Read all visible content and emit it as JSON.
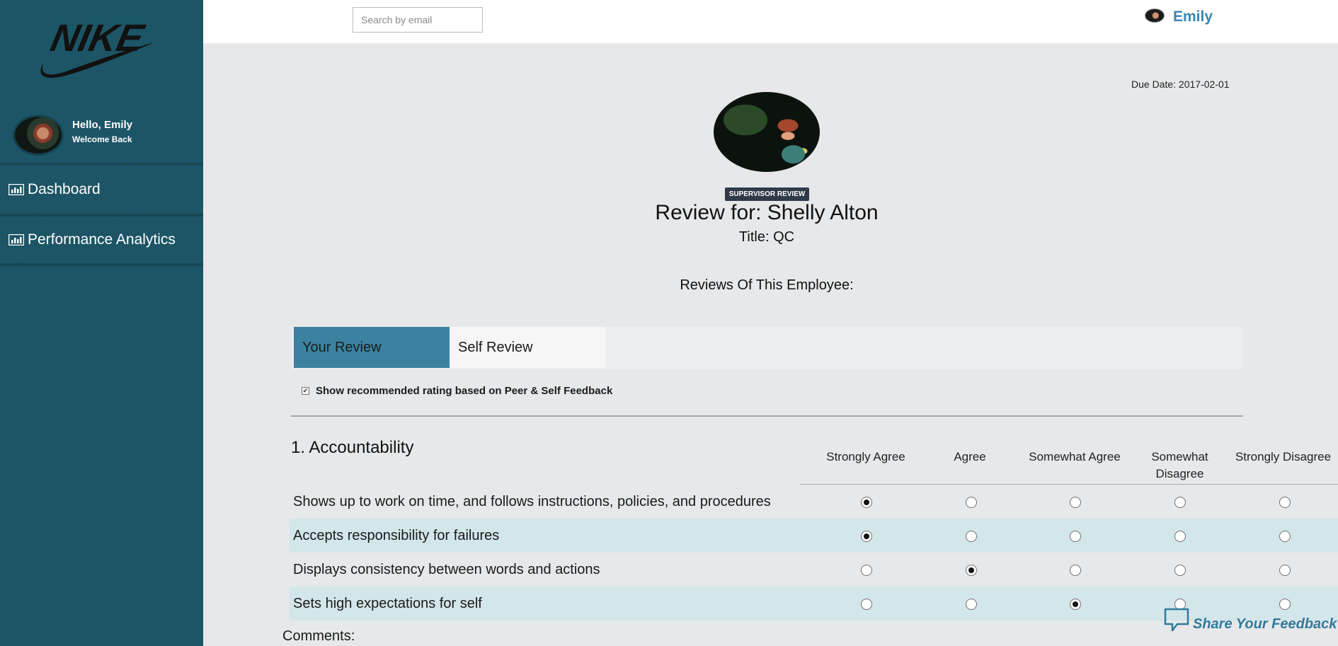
{
  "sidebar": {
    "logo_text": "NIKE",
    "user": {
      "greeting": "Hello, Emily",
      "subtitle": "Welcome Back"
    },
    "nav": [
      {
        "label": "Dashboard",
        "icon": "bar-chart-icon"
      },
      {
        "label": "Performance Analytics",
        "icon": "bar-chart-icon"
      }
    ]
  },
  "topbar": {
    "search_placeholder": "Search by email",
    "search_value": "",
    "username": "Emily"
  },
  "review": {
    "due_date": "Due Date: 2017-02-01",
    "badge": "SUPERVISOR REVIEW",
    "title": "Review for: Shelly Alton",
    "job_title": "Title: QC",
    "reviews_heading": "Reviews Of This Employee:",
    "tabs": [
      {
        "label": "Your Review",
        "active": true
      },
      {
        "label": "Self Review",
        "active": false
      }
    ],
    "recommended": {
      "label": "Show recommended rating based on Peer & Self Feedback",
      "checked": true
    },
    "section": {
      "title": "1.  Accountability",
      "columns": [
        "Strongly Agree",
        "Agree",
        "Somewhat Agree",
        "Somewhat Disagree",
        "Strongly Disagree"
      ],
      "questions": [
        {
          "text": "Shows up to work on time, and follows instructions, policies, and procedures",
          "selected": 0
        },
        {
          "text": "Accepts responsibility for failures",
          "selected": 0
        },
        {
          "text": "Displays consistency between words and actions",
          "selected": 1
        },
        {
          "text": "Sets high expectations for self",
          "selected": 2
        }
      ]
    },
    "comments_label": "Comments:"
  },
  "feedback": {
    "label": "Share Your Feedback",
    "icon": "speech-bubble-icon"
  },
  "colors": {
    "sidebar": "#1c5566",
    "accent": "#3b82a0",
    "link": "#3a86ad",
    "row_shade": "#d3e6ea"
  }
}
